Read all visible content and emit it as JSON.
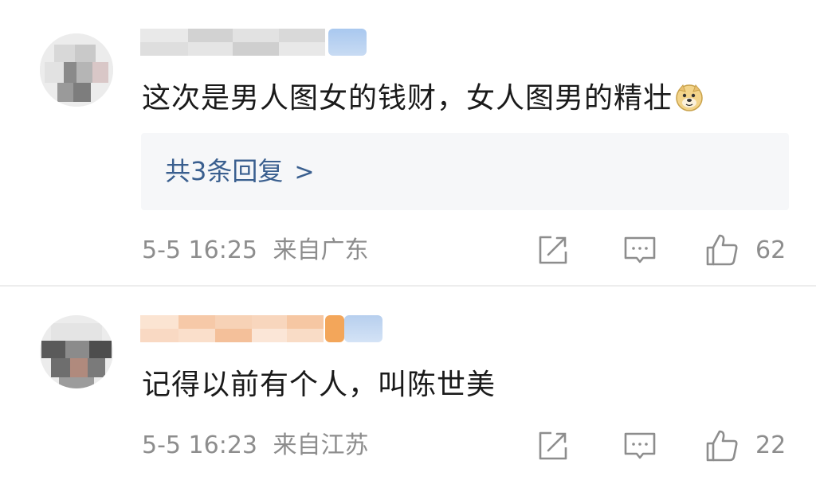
{
  "comments": [
    {
      "text": "这次是男人图女的钱财，女人图男的精壮",
      "emoji": "doge-emoji",
      "replies_label": "共3条回复",
      "timestamp": "5-5 16:25",
      "location": "来自广东",
      "likes": "62"
    },
    {
      "text": "记得以前有个人，叫陈世美",
      "timestamp": "5-5 16:23",
      "location": "来自江苏",
      "likes": "22"
    }
  ],
  "colors": {
    "text": "#1a1a1a",
    "meta": "#8d8d8d",
    "link": "#3a5f8f",
    "reply_box_bg": "#f6f7f9",
    "divider": "#ededed"
  }
}
